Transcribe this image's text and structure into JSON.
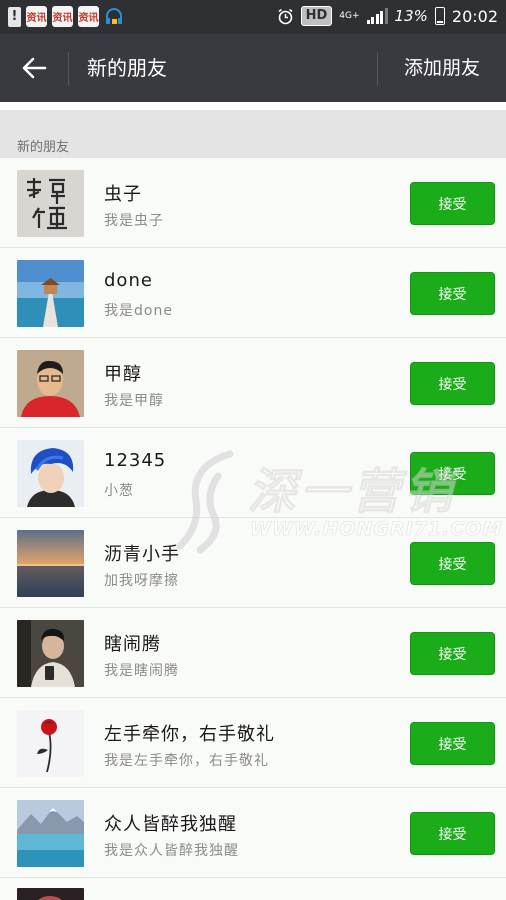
{
  "status_bar": {
    "app_badges": [
      "资讯",
      "资讯",
      "资讯"
    ],
    "hd": "HD",
    "network": "4G+",
    "battery": "13%",
    "time": "20:02"
  },
  "header": {
    "title": "新的朋友",
    "add_friend_label": "添加朋友"
  },
  "section_label": "新的朋友",
  "friend_requests": [
    {
      "name": "虫子",
      "message": "我是虫子",
      "action": "接受",
      "avatar": "calligraphy-avatar"
    },
    {
      "name": "done",
      "message": "我是done",
      "action": "接受",
      "avatar": "pier-avatar"
    },
    {
      "name": "甲醇",
      "message": "我是甲醇",
      "action": "接受",
      "avatar": "man-red-shirt-avatar"
    },
    {
      "name": "12345",
      "message": "小葱",
      "action": "接受",
      "avatar": "blue-hair-avatar"
    },
    {
      "name": "沥青小手",
      "message": "加我呀摩擦",
      "action": "接受",
      "avatar": "sunset-avatar"
    },
    {
      "name": "瞎闹腾",
      "message": "我是瞎闹腾",
      "action": "接受",
      "avatar": "mirror-selfie-avatar"
    },
    {
      "name": "左手牵你，右手敬礼",
      "message": "我是左手牵你，右手敬礼",
      "action": "接受",
      "avatar": "red-rose-avatar"
    },
    {
      "name": "众人皆醉我独醒",
      "message": "我是众人皆醉我独醒",
      "action": "接受",
      "avatar": "mountain-lake-avatar"
    }
  ],
  "watermark": {
    "brand": "深一营销",
    "url": "WWW.HONGRI71.COM"
  },
  "colors": {
    "accent_green": "#1aad19",
    "title_bar": "#393a3f",
    "status_bar": "#2f3033"
  }
}
